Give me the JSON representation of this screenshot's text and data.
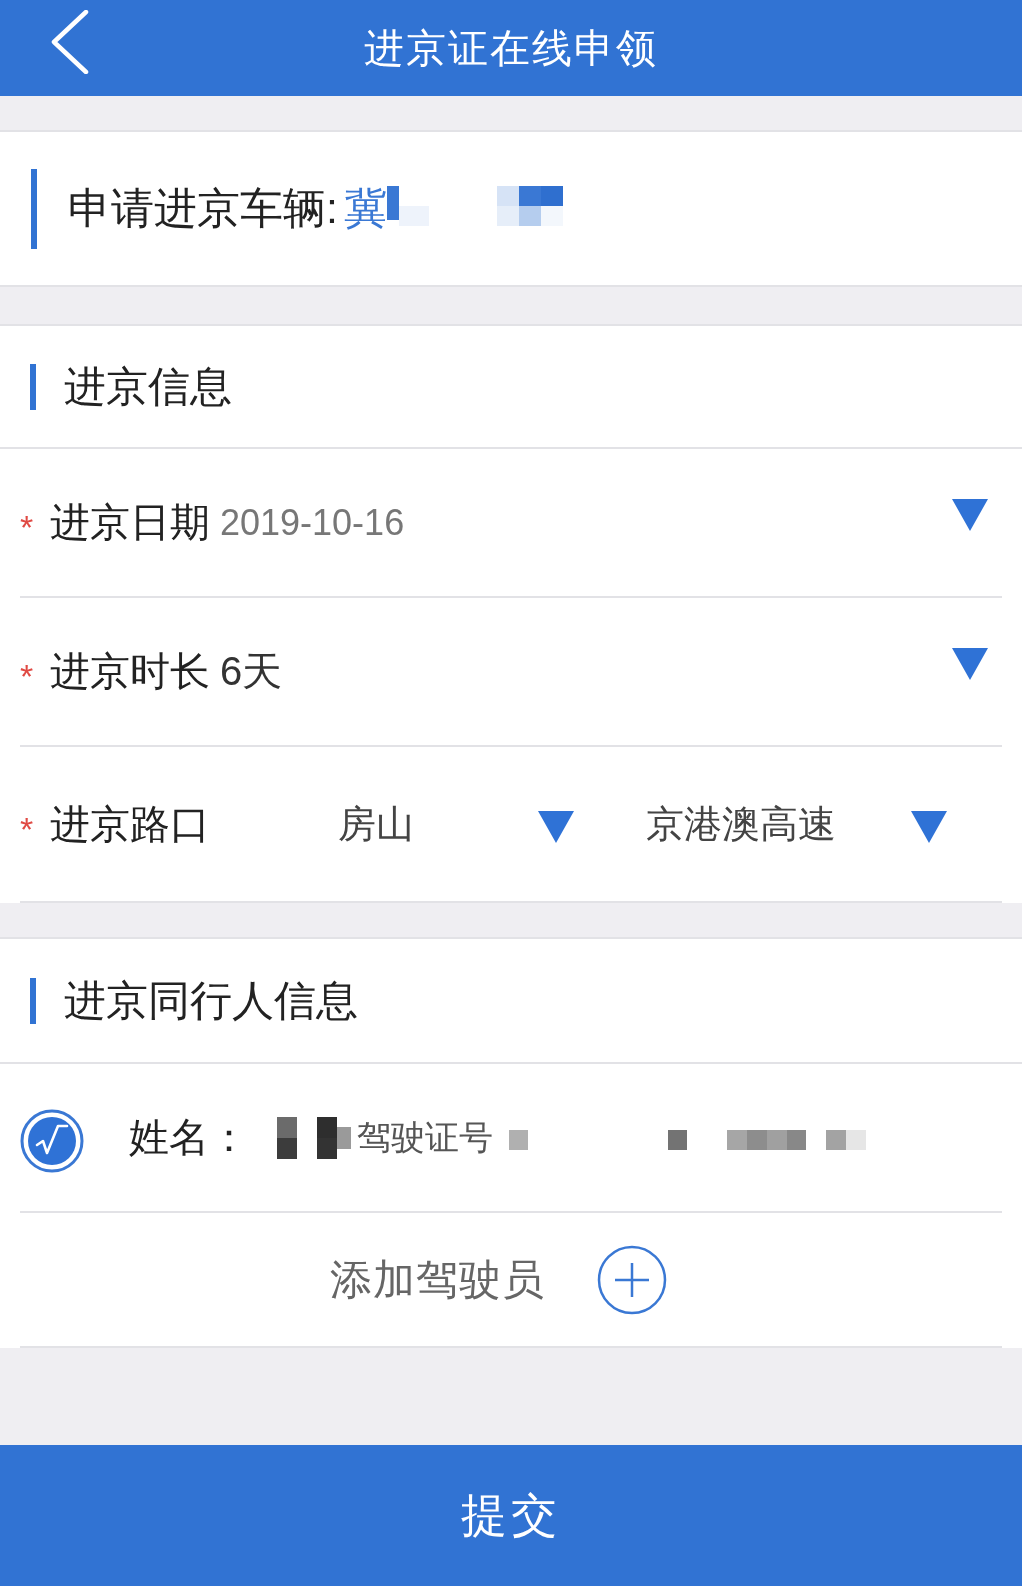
{
  "header": {
    "title": "进京证在线申领"
  },
  "vehicle": {
    "label": "申请进京车辆:",
    "plate": "冀"
  },
  "entry_info": {
    "title": "进京信息",
    "fields": [
      {
        "kind": "single",
        "required_mark": "*",
        "label": "进京日期",
        "value": "2019-10-16",
        "muted": true
      },
      {
        "kind": "single",
        "required_mark": "*",
        "label": "进京时长",
        "value": "6天",
        "muted": false
      },
      {
        "kind": "double",
        "required_mark": "*",
        "label": "进京路口",
        "value": "房山",
        "value_2": "京港澳高速",
        "muted": false
      }
    ]
  },
  "companions": {
    "title": "进京同行人信息",
    "people": [
      {
        "selected": true,
        "name_label": "姓名：",
        "license_label": "驾驶证号"
      }
    ],
    "add_label": "添加驾驶员"
  },
  "submit": "提交"
}
